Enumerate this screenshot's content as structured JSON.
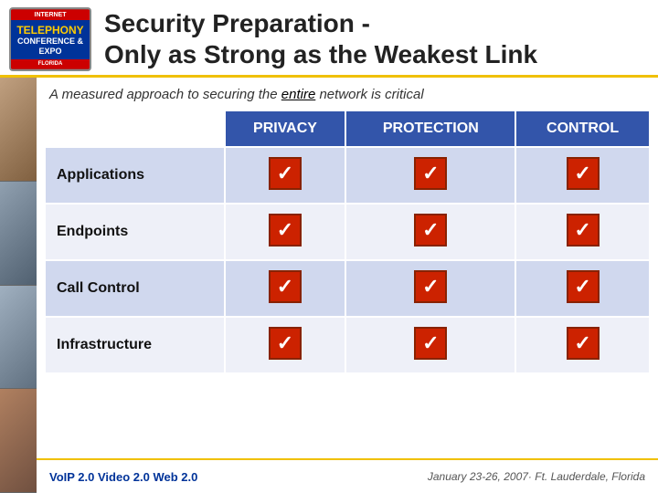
{
  "header": {
    "logo": {
      "line1": "INTERNET",
      "line2": "TELEPHONY",
      "line3": "CONFERENCE & EXPO",
      "location": "FLORIDA"
    },
    "title_line1": "Security Preparation -",
    "title_line2": "Only as Strong as the Weakest Link"
  },
  "subtitle": {
    "text_before": "A measured approach to securing the ",
    "emphasis": "entire",
    "text_after": " network is critical"
  },
  "table": {
    "col_headers": [
      "",
      "PRIVACY",
      "PROTECTION",
      "CONTROL"
    ],
    "rows": [
      {
        "label": "Applications",
        "privacy": true,
        "protection": true,
        "control": true
      },
      {
        "label": "Endpoints",
        "privacy": true,
        "protection": true,
        "control": true
      },
      {
        "label": "Call Control",
        "privacy": true,
        "protection": true,
        "control": true
      },
      {
        "label": "Infrastructure",
        "privacy": true,
        "protection": true,
        "control": true
      }
    ]
  },
  "footer": {
    "left": "VoIP 2.0  Video 2.0  Web 2.0",
    "right": "January 23-26, 2007· Ft. Lauderdale, Florida"
  }
}
